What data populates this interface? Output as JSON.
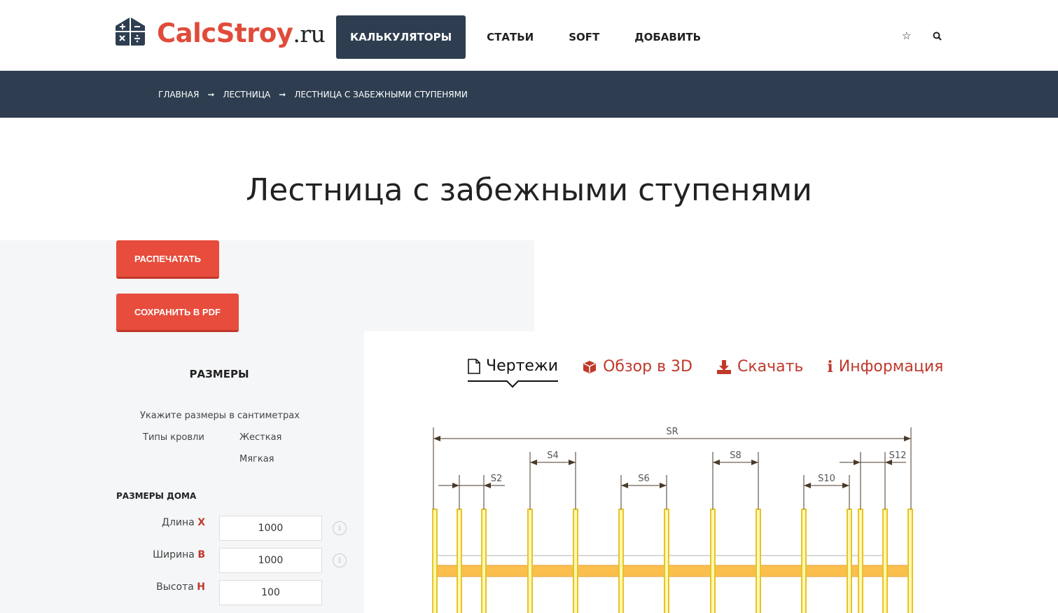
{
  "header": {
    "logo_main": "CalcStroy",
    "logo_suffix": ".ru",
    "nav": [
      {
        "label": "КАЛЬКУЛЯТОРЫ"
      },
      {
        "label": "СТАТЬИ"
      },
      {
        "label": "SOFT"
      },
      {
        "label": "ДОБАВИТЬ"
      }
    ]
  },
  "breadcrumb": [
    "ГЛАВНАЯ",
    "ЛЕСТНИЦА",
    "ЛЕСТНИЦА С ЗАБЕЖНЫМИ СТУПЕНЯМИ"
  ],
  "breadcrumb_sep": "➞",
  "page_title": "Лестница с забежными ступенями",
  "buttons": {
    "print": "РАСПЕЧАТАТЬ",
    "pdf": "СОХРАНИТЬ В PDF"
  },
  "form": {
    "title": "РАЗМЕРЫ",
    "hint": "Укажите размеры в сантиметрах",
    "roof_label": "Типы кровли",
    "roof_options": [
      "Жесткая",
      "Мягкая"
    ],
    "house_title": "РАЗМЕРЫ ДОМА",
    "fields": [
      {
        "label": "Длина",
        "letter": "X",
        "value": "1000"
      },
      {
        "label": "Ширина",
        "letter": "B",
        "value": "1000"
      },
      {
        "label": "Высота",
        "letter": "H",
        "value": "100"
      }
    ]
  },
  "tabs": [
    {
      "label": "Чертежи",
      "icon": "file-icon"
    },
    {
      "label": "Обзор в 3D",
      "icon": "cube-icon"
    },
    {
      "label": "Скачать",
      "icon": "download-icon"
    },
    {
      "label": "Информация",
      "icon": "info-icon"
    }
  ],
  "drawing": {
    "total_label": "SR",
    "dim_labels": [
      "S2",
      "S4",
      "S6",
      "S8",
      "S10",
      "S12"
    ]
  },
  "colors": {
    "accent": "#e74c3c",
    "dark": "#2e3e50",
    "rafter": "#e6c42a",
    "beam": "#fbbf4d"
  }
}
